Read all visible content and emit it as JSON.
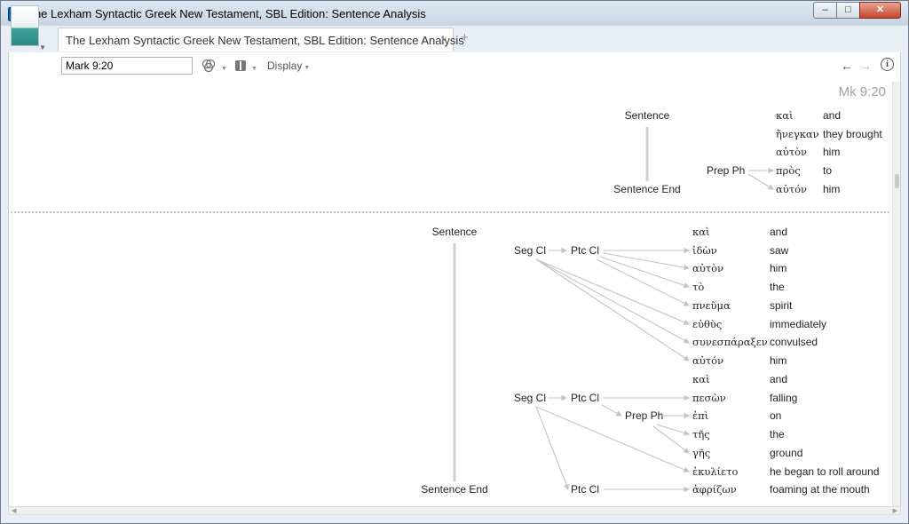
{
  "window": {
    "title": "The Lexham Syntactic Greek New Testament, SBL Edition: Sentence Analysis",
    "min_glyph": "–",
    "max_glyph": "□",
    "close_glyph": "✕"
  },
  "tab": {
    "label": "The Lexham Syntactic Greek New Testament, SBL Edition: Sentence Analysis",
    "close_glyph": "×",
    "add_glyph": "+"
  },
  "toolbar": {
    "reference_value": "Mark 9:20",
    "display_label": "Display",
    "back_glyph": "←",
    "forward_glyph": "→",
    "info_glyph": "i",
    "icons": [
      "book-cover-icon",
      "visual-filter-icon",
      "panel-icon",
      "back-arrow-icon",
      "forward-arrow-icon",
      "info-icon"
    ]
  },
  "content": {
    "verse_ref": "Mk 9:20",
    "sentences": [
      {
        "start": "Sentence",
        "end": "Sentence End",
        "nodes": [
          "Prep Ph"
        ],
        "words": [
          {
            "greek": "καὶ",
            "english": "and"
          },
          {
            "greek": "ἤνεγκαν",
            "english": "they brought"
          },
          {
            "greek": "αὐτὸν",
            "english": "him"
          },
          {
            "greek": "πρὸς",
            "english": "to"
          },
          {
            "greek": "αὐτόν",
            "english": "him"
          }
        ]
      },
      {
        "start": "Sentence",
        "end": "Sentence End",
        "nodes": [
          "Seg Cl",
          "Ptc Cl",
          "Seg Cl",
          "Ptc Cl",
          "Prep Ph",
          "Ptc Cl"
        ],
        "words": [
          {
            "greek": "καὶ",
            "english": "and"
          },
          {
            "greek": "ἰδὼν",
            "english": "saw"
          },
          {
            "greek": "αὐτὸν",
            "english": "him"
          },
          {
            "greek": "τὸ",
            "english": "the"
          },
          {
            "greek": "πνεῦμα",
            "english": "spirit"
          },
          {
            "greek": "εὐθὺς",
            "english": "immediately"
          },
          {
            "greek": "συνεσπάραξεν",
            "english": "convulsed"
          },
          {
            "greek": "αὐτόν",
            "english": "him"
          },
          {
            "greek": "καὶ",
            "english": "and"
          },
          {
            "greek": "πεσὼν",
            "english": "falling"
          },
          {
            "greek": "ἐπὶ",
            "english": "on"
          },
          {
            "greek": "τῆς",
            "english": "the"
          },
          {
            "greek": "γῆς",
            "english": "ground"
          },
          {
            "greek": "ἐκυλίετο",
            "english": "he began to roll around"
          },
          {
            "greek": "ἀφρίζων",
            "english": "foaming at the mouth"
          }
        ]
      }
    ]
  }
}
